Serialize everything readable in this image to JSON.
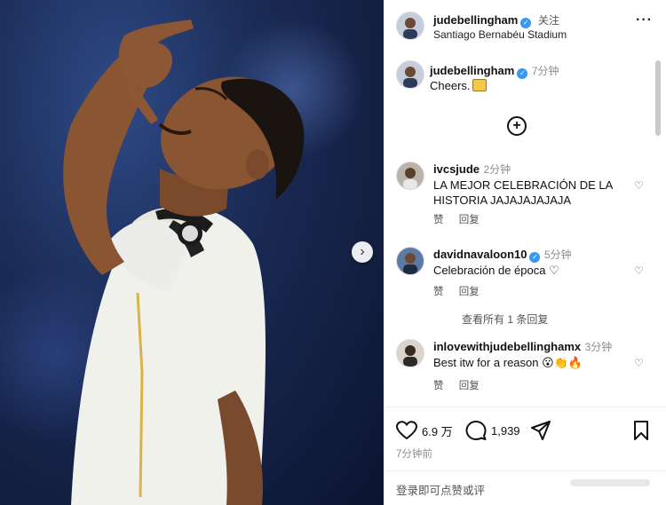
{
  "header": {
    "username": "judebellingham",
    "follow_label": "关注",
    "location": "Santiago Bernabéu Stadium",
    "more_icon": "more-icon"
  },
  "caption": {
    "username": "judebellingham",
    "time": "7分钟",
    "text": "Cheers."
  },
  "comments": [
    {
      "username": "ivcsjude",
      "time": "2分钟",
      "text": "LA MEJOR CELEBRACIÓN DE LA HISTORIA JAJAJAJAJAJA",
      "like_label": "赞",
      "reply_label": "回复"
    },
    {
      "username": "davidnavaloon10",
      "time": "5分钟",
      "text": "Celebración de época ♡",
      "like_label": "赞",
      "reply_label": "回复",
      "view_replies": "查看所有 1 条回复"
    },
    {
      "username": "inlovewithjudebellinghamx",
      "time": "3分钟",
      "text": "Best itw for a reason 😮👏🔥",
      "like_label": "赞",
      "reply_label": "回复"
    }
  ],
  "actions": {
    "likes": "6.9 万",
    "comments": "1,939",
    "post_time": "7分钟前"
  },
  "footer": {
    "login_prompt": "登录即可点赞或评"
  },
  "colors": {
    "verified": "#3897f0",
    "muted": "#8e8e8e"
  }
}
